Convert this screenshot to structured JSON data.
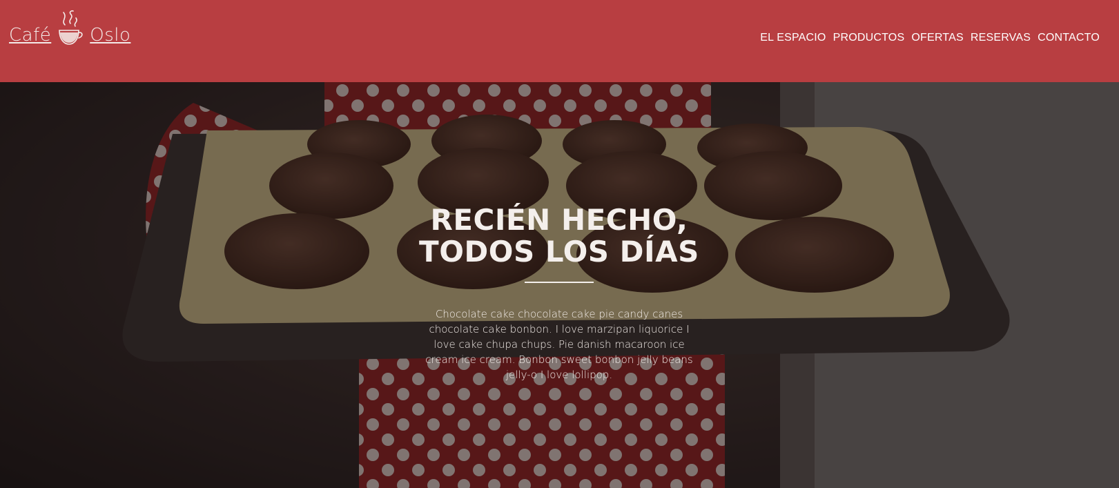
{
  "brand": {
    "name_left": "Café",
    "name_right": "Oslo",
    "logo_icon": "coffee-cup-icon",
    "header_color": "#b83e41"
  },
  "nav": {
    "items": [
      "EL ESPACIO",
      "PRODUCTOS",
      "OFERTAS",
      "RESERVAS",
      "CONTACTO"
    ]
  },
  "hero": {
    "title_line1": "RECIÉN HECHO,",
    "title_line2": "TODOS LOS DÍAS",
    "text": "Chocolate cake chocolate cake pie candy canes chocolate cake bonbon. I love marzipan liquorice I love cake chupa chups. Pie danish macaroon ice cream ice cream. Bonbon sweet bonbon jelly beans jelly-o I love lollipop.",
    "background_image": "muffin-tray-photo"
  }
}
